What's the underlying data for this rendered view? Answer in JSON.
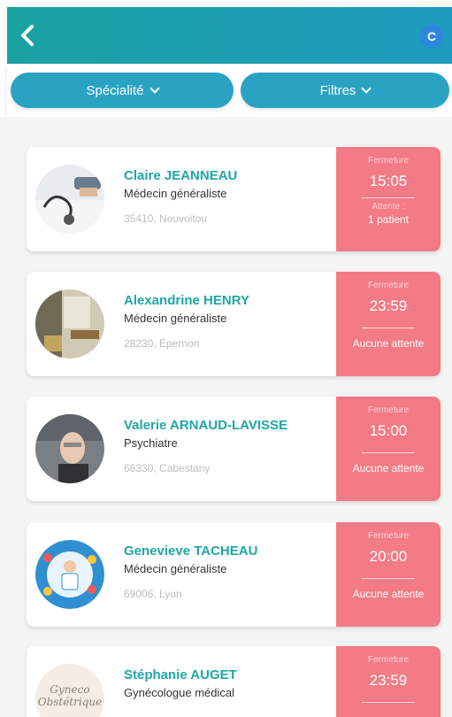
{
  "header": {
    "back_icon": "chevron-left-icon",
    "avatar_initial": "C",
    "gradient": [
      "#1aa2a2",
      "#1f9bbf"
    ]
  },
  "filters": {
    "specialite": "Spécialité",
    "filtres": "Filtres"
  },
  "colors": {
    "accent": "#1ea7a4",
    "pill": "#2aa3c3",
    "status_bg": "#f27b85"
  },
  "doctors": [
    {
      "name": "Claire JEANNEAU",
      "specialty": "Médecin généraliste",
      "location": "35410, Nouvoitou",
      "closing_label": "Fermeture",
      "closing_time": "15:05",
      "wait_label": "Attente :",
      "wait": "1 patient",
      "photo_icon": "stethoscope-photo"
    },
    {
      "name": "Alexandrine HENRY",
      "specialty": "Médecin généraliste",
      "location": "28230, Épernon",
      "closing_label": "Fermeture",
      "closing_time": "23:59",
      "wait_label": "",
      "wait": "Aucune attente",
      "photo_icon": "office-photo"
    },
    {
      "name": "Valerie ARNAUD-LAVISSE",
      "specialty": "Psychiatre",
      "location": "66330, Cabestany",
      "closing_label": "Fermeture",
      "closing_time": "15:00",
      "wait_label": "",
      "wait": "Aucune attente",
      "photo_icon": "portrait-photo"
    },
    {
      "name": "Genevieve TACHEAU",
      "specialty": "Médecin généraliste",
      "location": "69006, Lyon",
      "closing_label": "Fermeture",
      "closing_time": "20:00",
      "wait_label": "",
      "wait": "Aucune attente",
      "photo_icon": "doctor-illustration"
    },
    {
      "name": "Stéphanie AUGET",
      "specialty": "Gynécologue médical",
      "location": "",
      "closing_label": "Fermeture",
      "closing_time": "23:59",
      "wait_label": "",
      "wait": "",
      "logo_text": [
        "Gyneco",
        "Obstétrique"
      ],
      "photo_icon": "gyneco-logo"
    }
  ]
}
